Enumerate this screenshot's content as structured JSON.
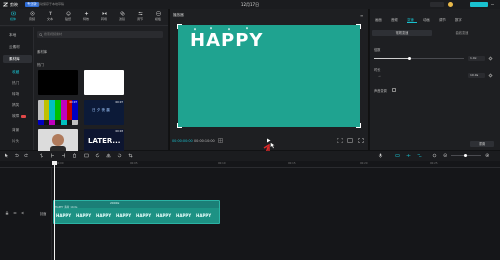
{
  "titlebar": {
    "app_name": "剪映",
    "badge": "专业版",
    "notice": "自动保存于本地草稿",
    "project_title": "12月17日"
  },
  "tools": [
    {
      "label": "媒体",
      "icon": "media-icon"
    },
    {
      "label": "音频",
      "icon": "audio-icon"
    },
    {
      "label": "文本",
      "icon": "text-icon"
    },
    {
      "label": "贴纸",
      "icon": "sticker-icon"
    },
    {
      "label": "特效",
      "icon": "effects-icon"
    },
    {
      "label": "转场",
      "icon": "transition-icon"
    },
    {
      "label": "滤镜",
      "icon": "filter-icon"
    },
    {
      "label": "调节",
      "icon": "adjust-icon"
    },
    {
      "label": "模板",
      "icon": "template-icon"
    }
  ],
  "side_nav": {
    "local": "本地",
    "cloud": "云素材",
    "library": "素材库",
    "sub_items": [
      "收藏",
      "热门",
      "转场",
      "搞笑",
      "故障",
      "背景",
      "片头"
    ]
  },
  "search": {
    "placeholder": "搜索视频素材"
  },
  "library_label": "素材库",
  "hot_label": "热门",
  "thumbnails": {
    "t3_time": "00:07",
    "t4_time": "00:07",
    "t4_caption": "日 夕 夜 晨",
    "t6_title": "LATER...",
    "t6_time": "00:03"
  },
  "player": {
    "label": "播放器",
    "canvas_text": "HAPPY",
    "time_current": "00:00:00:00",
    "time_total": "00:00:10:00"
  },
  "right_panel": {
    "tabs": [
      "画面",
      "音频",
      "变速",
      "动画",
      "调节",
      "数字"
    ],
    "selected_tab": "变速",
    "sub_tabs": [
      "常规变速",
      "曲线变速"
    ],
    "multiplier_label": "倍数",
    "multiplier_value": "1.0x",
    "duration_label": "时长",
    "duration_value": "10.0s",
    "pitch_label": "声音变调",
    "reset": "重置"
  },
  "timeline": {
    "ticks": [
      "00:00",
      "00:05",
      "00:10",
      "00:15",
      "00:20",
      "00:25",
      "00:30"
    ],
    "track_name": "封面",
    "clip_label": "2000x",
    "clip_info": "HAPPY 素材 10.0s"
  },
  "colors": {
    "accent": "#19c1cf",
    "canvas": "#1fa390",
    "clip": "#1b7f77",
    "arrow": "#e12a2a"
  }
}
